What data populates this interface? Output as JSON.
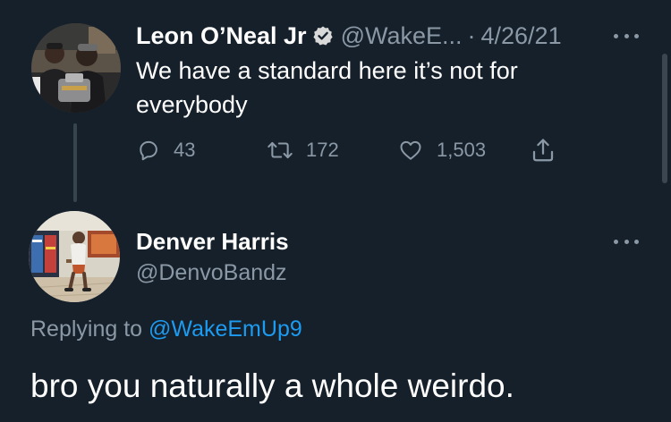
{
  "colors": {
    "background": "#15202b",
    "text_primary": "#ffffff",
    "text_secondary": "#8b98a5",
    "link": "#1d9bf0",
    "verified_badge": "#d9d9d9"
  },
  "parent_tweet": {
    "author_name": "Leon O’Neal Jr",
    "verified": true,
    "handle": "@WakeE...",
    "separator": "·",
    "date": "4/26/21",
    "text": "We have a standard here it’s not for everybody",
    "avatar_icon": "avatar-photo",
    "more_icon": "more-horizontal-icon",
    "actions": {
      "reply": {
        "icon": "reply-icon",
        "count": "43"
      },
      "retweet": {
        "icon": "retweet-icon",
        "count": "172"
      },
      "like": {
        "icon": "heart-icon",
        "count": "1,503"
      },
      "share": {
        "icon": "share-icon"
      }
    }
  },
  "reply_tweet": {
    "author_name": "Denver Harris",
    "handle": "@DenvoBandz",
    "replying_prefix": "Replying to ",
    "replying_to": "@WakeEmUp9",
    "text": "bro you naturally a whole weirdo.",
    "avatar_icon": "avatar-photo",
    "more_icon": "more-horizontal-icon"
  }
}
